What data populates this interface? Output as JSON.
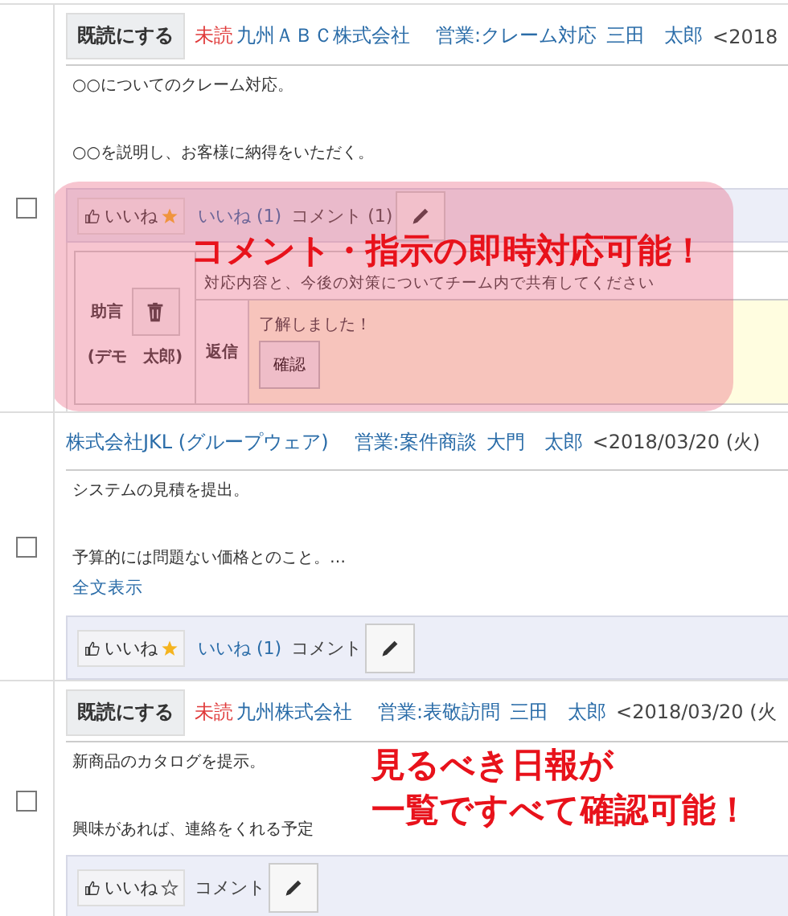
{
  "reports": [
    {
      "checked": false,
      "mark_read_button": "既読にする",
      "unread_label": "未読",
      "company": "九州ＡＢＣ株式会社",
      "category": "営業:クレーム対応",
      "author": "三田　太郎",
      "date": "<2018",
      "paragraphs": [
        "○○についてのクレーム対応。",
        "○○を説明し、お客様に納得をいただく。"
      ],
      "actions": {
        "like_button": "いいね",
        "liked": true,
        "like_count": "いいね (1)",
        "comment_label": "コメント (1)"
      },
      "comments": [
        {
          "author_label": "助言",
          "author_name": "(デモ　太郎)",
          "text": "対応内容と、今後の対策についてチーム内で共有してください",
          "reply_label": "返信",
          "reply": "了解しました！",
          "confirm_button": "確認"
        }
      ],
      "callout": {
        "kind": "panel",
        "lines": [
          "コメント・指示の即時対応可能！"
        ]
      }
    },
    {
      "checked": false,
      "company": "株式会社JKL (グループウェア)",
      "category": "営業:案件商談",
      "author": "大門　太郎",
      "date": "<2018/03/20 (火)",
      "paragraphs": [
        "システムの見積を提出。",
        "予算的には問題ない価格とのこと。…"
      ],
      "more_link": "全文表示",
      "actions": {
        "like_button": "いいね",
        "liked": true,
        "like_count": "いいね (1)",
        "comment_label": "コメント"
      }
    },
    {
      "checked": false,
      "mark_read_button": "既読にする",
      "unread_label": "未読",
      "company": "九州株式会社",
      "category": "営業:表敬訪問",
      "author": "三田　太郎",
      "date": "<2018/03/20 (火",
      "paragraphs": [
        "新商品のカタログを提示。",
        "興味があれば、連絡をくれる予定"
      ],
      "actions": {
        "like_button": "いいね",
        "liked": false,
        "comment_label": "コメント"
      },
      "callout": {
        "kind": "text",
        "lines": [
          "見るべき日報が",
          "一覧ですべて確認可能！"
        ]
      }
    }
  ]
}
